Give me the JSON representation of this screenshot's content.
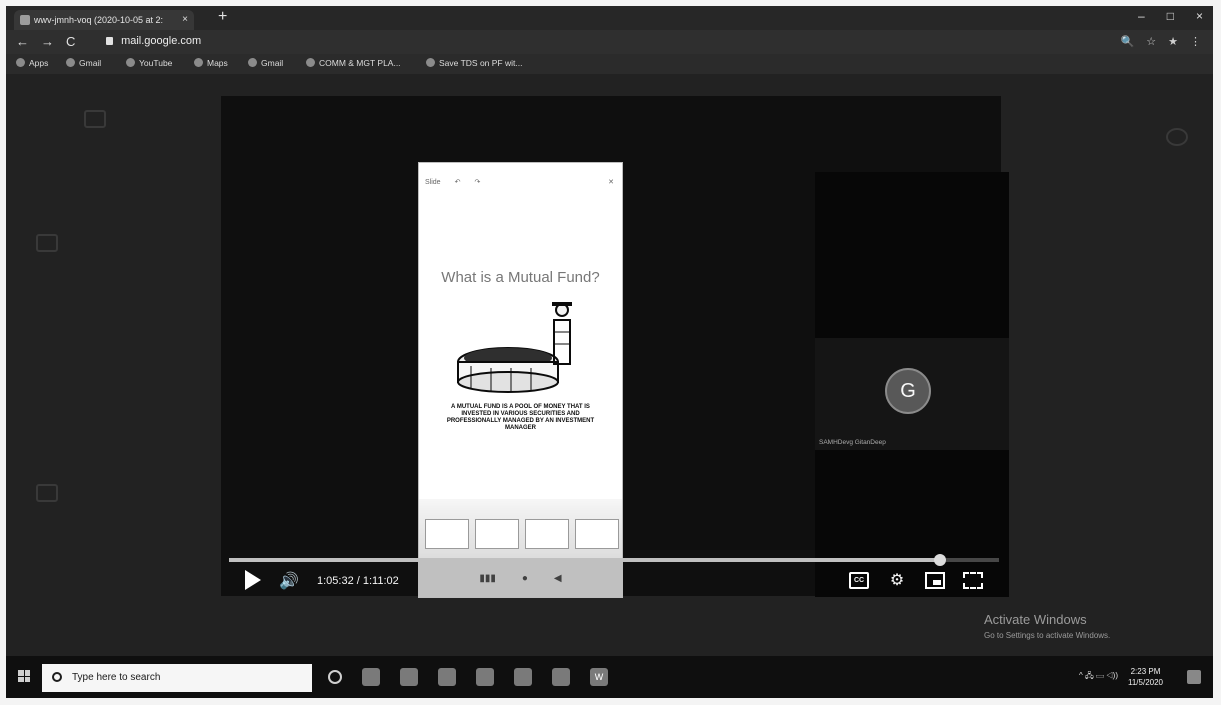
{
  "browser": {
    "tab_title": "wwv-jmnh-voq (2020-10-05 at 2:",
    "tab_close": "×",
    "new_tab": "+",
    "url": "mail.google.com",
    "nav": {
      "back": "←",
      "forward": "→",
      "reload": "C"
    },
    "window_controls": {
      "minimize": "–",
      "maximize": "□",
      "close": "×"
    },
    "toolbar_icons": {
      "zoom": "🔍",
      "star": "☆",
      "ext": "★",
      "menu": "⋮"
    }
  },
  "bookmarks": [
    "Apps",
    "Gmail",
    "YouTube",
    "Maps",
    "Gmail",
    "COMM & MGT PLA...",
    "Save TDS on PF wit..."
  ],
  "player": {
    "slide_title": "What is a Mutual Fund?",
    "slide_text": "A MUTUAL FUND IS A POOL OF MONEY THAT IS INVESTED IN VARIOUS SECURITIES AND PROFESSIONALLY MANAGED BY AN INVESTMENT MANAGER",
    "phone_toolbar": {
      "left": "Slide",
      "close": "✕"
    },
    "participant_initial": "G",
    "participant_name": "SAMHDevg GitanDeep",
    "time_current": "1:05:32",
    "time_sep": " / ",
    "time_total": "1:11:02",
    "progress": 0.923,
    "cc_label": "CC",
    "volume_icon": "🔊",
    "gear_icon": "⚙"
  },
  "activate": {
    "title": "Activate Windows",
    "subtitle": "Go to Settings to activate Windows."
  },
  "taskbar": {
    "search_placeholder": "Type here to search",
    "clock_time": "2:23 PM",
    "clock_date": "11/5/2020",
    "tray_text": "^ 🖧 ▭ ◁))",
    "word_label": "W"
  }
}
